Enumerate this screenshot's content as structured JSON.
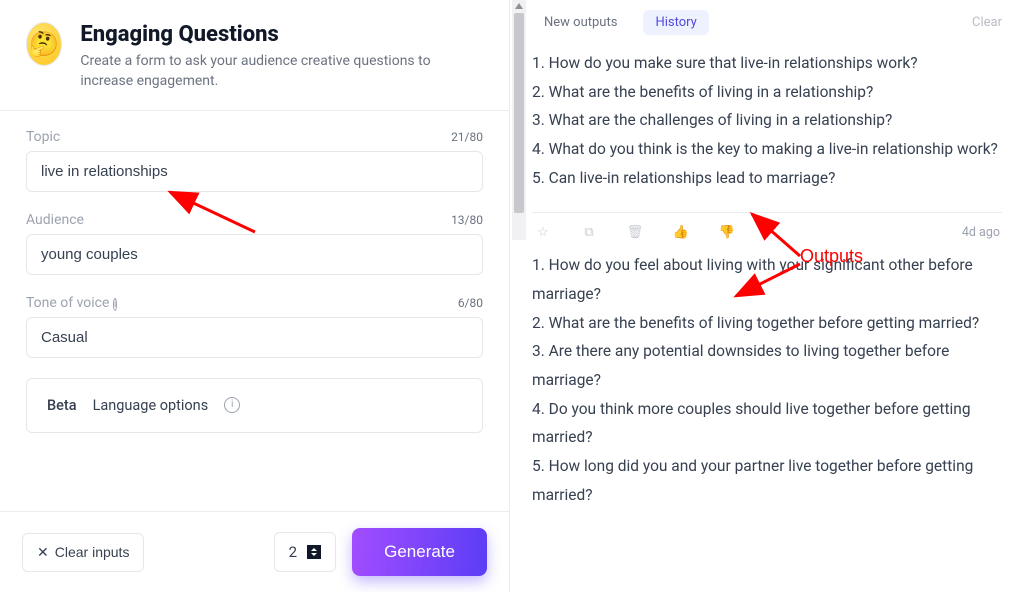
{
  "header": {
    "title": "Engaging Questions",
    "subtitle": "Create a form to ask your audience creative questions to increase engagement."
  },
  "form": {
    "topic": {
      "label": "Topic",
      "value": "live in relationships",
      "count": "21/80"
    },
    "audience": {
      "label": "Audience",
      "value": "young couples",
      "count": "13/80"
    },
    "tone": {
      "label": "Tone of voice",
      "value": "Casual",
      "count": "6/80"
    },
    "lang": {
      "beta": "Beta",
      "label": "Language options"
    }
  },
  "footer": {
    "clear": "Clear inputs",
    "qty": "2",
    "generate": "Generate"
  },
  "tabs": {
    "new": "New outputs",
    "history": "History",
    "clear": "Clear"
  },
  "outputs": [
    {
      "time": "",
      "text": "1. How do you make sure that live-in relationships work?\n2. What are the benefits of living in a relationship?\n3. What are the challenges of living in a relationship?\n4. What do you think is the key to making a live-in relationship work?\n5. Can live-in relationships lead to marriage?"
    },
    {
      "time": "4d ago",
      "text": "1. How do you feel about living with your significant other before marriage?\n2. What are the benefits of living together before getting married?\n3. Are there any potential downsides to living together before marriage?\n4. Do you think more couples should live together before getting married?\n5. How long did you and your partner live together before getting married?"
    }
  ],
  "annotation_label": "Outputs"
}
